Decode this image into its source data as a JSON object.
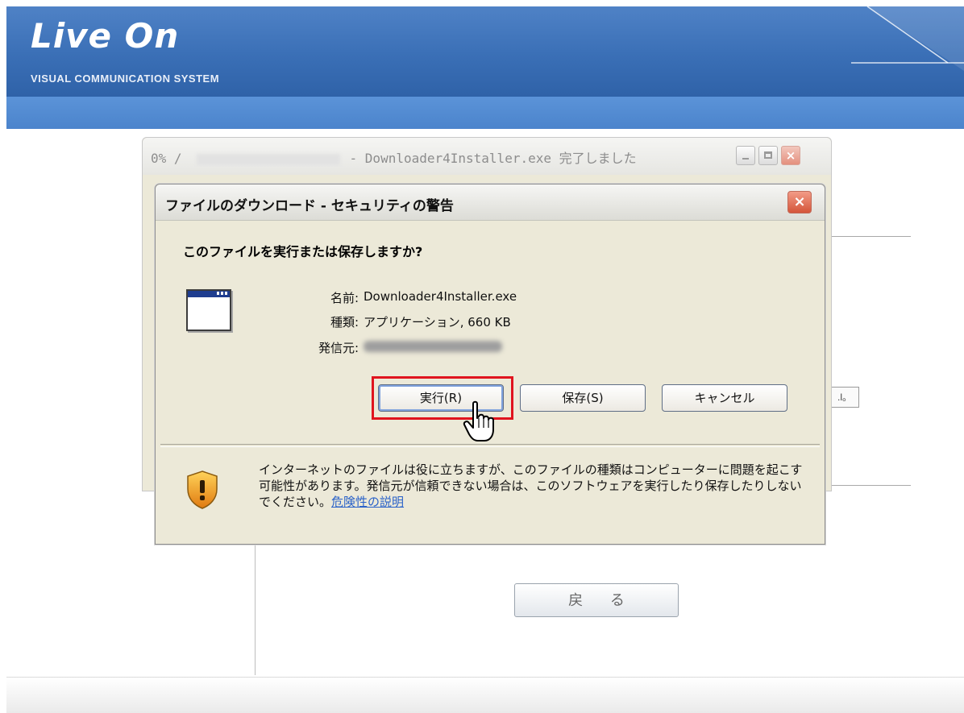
{
  "header": {
    "brand": "Live On",
    "tagline": "VISUAL COMMUNICATION SYSTEM"
  },
  "background_page": {
    "back_button_label": "戻 る",
    "fragment_text": ".l。"
  },
  "progress_window": {
    "title_prefix": "0% /",
    "title_suffix": "- Downloader4Installer.exe 完了しました"
  },
  "dialog": {
    "title": "ファイルのダウンロード - セキュリティの警告",
    "close_label": "×",
    "question": "このファイルを実行または保存しますか?",
    "name_label": "名前:",
    "name_value": "Downloader4Installer.exe",
    "type_label": "種類:",
    "type_value": "アプリケーション, 660 KB",
    "publisher_label": "発信元:",
    "buttons": {
      "run": "実行(R)",
      "save": "保存(S)",
      "cancel": "キャンセル"
    },
    "warning": {
      "text": "インターネットのファイルは役に立ちますが、このファイルの種類はコンピューターに問題を起こす可能性があります。発信元が信頼できない場合は、このソフトウェアを実行したり保存したりしないでください。",
      "link": "危険性の説明"
    }
  },
  "colors": {
    "banner": "#3a6fb6",
    "highlight": "#e0141e",
    "link": "#2a62c9"
  }
}
